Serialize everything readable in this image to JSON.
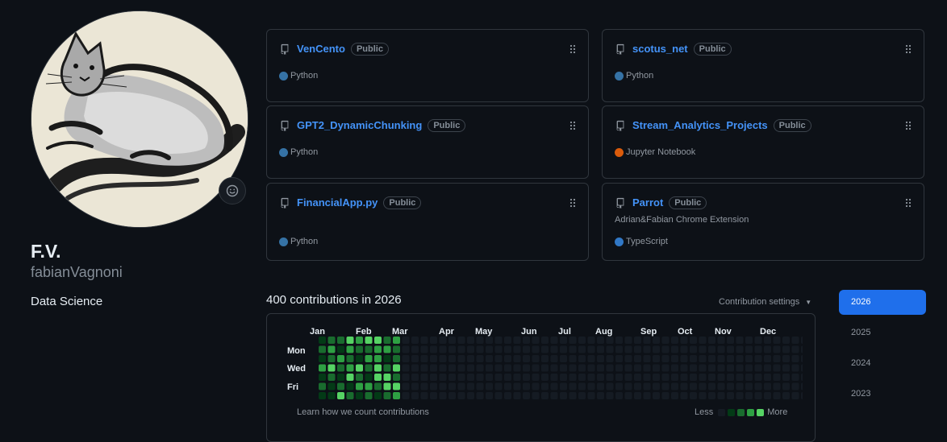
{
  "profile": {
    "full_name": "F.V.",
    "username": "fabianVagnoni",
    "bio": "Data Science",
    "avatar_icon": "cat-ink-painting-avatar",
    "status_icon": "smiley-icon"
  },
  "pinned_repos": [
    {
      "name": "VenCento",
      "visibility": "Public",
      "description": "",
      "language": "Python",
      "language_color": "#3572A5"
    },
    {
      "name": "scotus_net",
      "visibility": "Public",
      "description": "",
      "language": "Python",
      "language_color": "#3572A5"
    },
    {
      "name": "GPT2_DynamicChunking",
      "visibility": "Public",
      "description": "",
      "language": "Python",
      "language_color": "#3572A5"
    },
    {
      "name": "Stream_Analytics_Projects",
      "visibility": "Public",
      "description": "",
      "language": "Jupyter Notebook",
      "language_color": "#DA5B0B"
    },
    {
      "name": "FinancialApp.py",
      "visibility": "Public",
      "description": "",
      "language": "Python",
      "language_color": "#3572A5"
    },
    {
      "name": "Parrot",
      "visibility": "Public",
      "description": "Adrian&Fabian Chrome Extension",
      "language": "TypeScript",
      "language_color": "#3178c6"
    }
  ],
  "contributions": {
    "title": "400 contributions in 2026",
    "settings_label": "Contribution settings",
    "months": [
      "Jan",
      "Feb",
      "Mar",
      "Apr",
      "May",
      "Jun",
      "Jul",
      "Aug",
      "Sep",
      "Oct",
      "Nov",
      "Dec"
    ],
    "day_labels": [
      "Mon",
      "Wed",
      "Fri"
    ],
    "learn_link": "Learn how we count contributions",
    "legend_less": "Less",
    "legend_more": "More",
    "level_colors": [
      "#151b23",
      "#033a16",
      "#196c2e",
      "#2ea043",
      "#56d364"
    ],
    "weeks": [
      [
        1,
        2,
        1,
        3,
        1,
        2,
        1
      ],
      [
        2,
        3,
        2,
        4,
        2,
        1,
        1
      ],
      [
        2,
        1,
        3,
        2,
        1,
        2,
        4
      ],
      [
        4,
        3,
        2,
        3,
        4,
        1,
        2
      ],
      [
        3,
        2,
        1,
        4,
        2,
        3,
        1
      ],
      [
        4,
        2,
        3,
        2,
        1,
        3,
        2
      ],
      [
        4,
        3,
        3,
        4,
        4,
        2,
        1
      ],
      [
        2,
        3,
        1,
        2,
        4,
        4,
        2
      ],
      [
        3,
        2,
        2,
        4,
        2,
        4,
        3
      ],
      [
        0,
        0,
        0,
        0,
        0,
        0,
        0
      ],
      [
        0,
        0,
        0,
        0,
        0,
        0,
        0
      ],
      [
        0,
        0,
        0,
        0,
        0,
        0,
        0
      ],
      [
        0,
        0,
        0,
        0,
        0,
        0,
        0
      ],
      [
        0,
        0,
        0,
        0,
        0,
        0,
        0
      ],
      [
        0,
        0,
        0,
        0,
        0,
        0,
        0
      ],
      [
        0,
        0,
        0,
        0,
        0,
        0,
        0
      ],
      [
        0,
        0,
        0,
        0,
        0,
        0,
        0
      ],
      [
        0,
        0,
        0,
        0,
        0,
        0,
        0
      ],
      [
        0,
        0,
        0,
        0,
        0,
        0,
        0
      ],
      [
        0,
        0,
        0,
        0,
        0,
        0,
        0
      ],
      [
        0,
        0,
        0,
        0,
        0,
        0,
        0
      ],
      [
        0,
        0,
        0,
        0,
        0,
        0,
        0
      ],
      [
        0,
        0,
        0,
        0,
        0,
        0,
        0
      ],
      [
        0,
        0,
        0,
        0,
        0,
        0,
        0
      ],
      [
        0,
        0,
        0,
        0,
        0,
        0,
        0
      ],
      [
        0,
        0,
        0,
        0,
        0,
        0,
        0
      ],
      [
        0,
        0,
        0,
        0,
        0,
        0,
        0
      ],
      [
        0,
        0,
        0,
        0,
        0,
        0,
        0
      ],
      [
        0,
        0,
        0,
        0,
        0,
        0,
        0
      ],
      [
        0,
        0,
        0,
        0,
        0,
        0,
        0
      ],
      [
        0,
        0,
        0,
        0,
        0,
        0,
        0
      ],
      [
        0,
        0,
        0,
        0,
        0,
        0,
        0
      ],
      [
        0,
        0,
        0,
        0,
        0,
        0,
        0
      ],
      [
        0,
        0,
        0,
        0,
        0,
        0,
        0
      ],
      [
        0,
        0,
        0,
        0,
        0,
        0,
        0
      ],
      [
        0,
        0,
        0,
        0,
        0,
        0,
        0
      ],
      [
        0,
        0,
        0,
        0,
        0,
        0,
        0
      ],
      [
        0,
        0,
        0,
        0,
        0,
        0,
        0
      ],
      [
        0,
        0,
        0,
        0,
        0,
        0,
        0
      ],
      [
        0,
        0,
        0,
        0,
        0,
        0,
        0
      ],
      [
        0,
        0,
        0,
        0,
        0,
        0,
        0
      ],
      [
        0,
        0,
        0,
        0,
        0,
        0,
        0
      ],
      [
        0,
        0,
        0,
        0,
        0,
        0,
        0
      ],
      [
        0,
        0,
        0,
        0,
        0,
        0,
        0
      ],
      [
        0,
        0,
        0,
        0,
        0,
        0,
        0
      ],
      [
        0,
        0,
        0,
        0,
        0,
        0,
        0
      ],
      [
        0,
        0,
        0,
        0,
        0,
        0,
        0
      ],
      [
        0,
        0,
        0,
        0,
        0,
        0,
        0
      ],
      [
        0,
        0,
        0,
        0,
        0,
        0,
        0
      ],
      [
        0,
        0,
        0,
        0,
        0,
        0,
        0
      ],
      [
        0,
        0,
        0,
        0,
        0,
        0,
        0
      ],
      [
        0,
        0,
        0,
        0,
        0,
        0,
        0
      ],
      [
        0,
        0,
        0,
        0,
        0,
        0,
        0
      ]
    ]
  },
  "years": [
    "2026",
    "2025",
    "2024",
    "2023"
  ],
  "selected_year": "2026",
  "accent_color": "#1f6feb",
  "link_color": "#4493f8"
}
